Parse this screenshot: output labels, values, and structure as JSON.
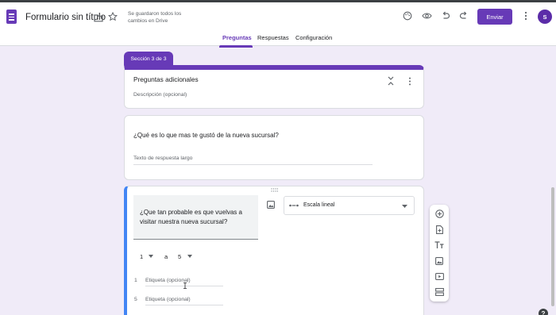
{
  "header": {
    "title": "Formulario sin título",
    "saved_status": "Se guardaron todos los cambios en Drive",
    "send_label": "Enviar",
    "avatar_letter": "S"
  },
  "tabs": [
    {
      "label": "Preguntas",
      "active": true
    },
    {
      "label": "Respuestas",
      "active": false
    },
    {
      "label": "Configuración",
      "active": false
    }
  ],
  "section": {
    "badge": "Sección 3 de 3",
    "title": "Preguntas adicionales",
    "description_placeholder": "Descripción (opcional)"
  },
  "question1": {
    "title": "¿Qué es lo que mas te gustó de la nueva sucursal?",
    "answer_placeholder": "Texto de respuesta largo"
  },
  "question2": {
    "title": "¿Que tan probable es que vuelvas a visitar nuestra nueva sucursal?",
    "type_label": "Escala lineal",
    "scale_from": "1",
    "scale_to_word": "a",
    "scale_to": "5",
    "label_1_num": "1",
    "label_1_placeholder": "Etiqueta (opcional)",
    "label_5_num": "5",
    "label_5_placeholder": "Etiqueta (opcional)"
  },
  "colors": {
    "accent": "#673ab7",
    "background": "#f0ebf8",
    "active_border": "#4285f4"
  },
  "icons": [
    "folder-icon",
    "star-icon",
    "palette-icon",
    "eye-icon",
    "undo-icon",
    "redo-icon",
    "more-vert-icon",
    "add-circle-icon",
    "import-icon",
    "title-icon",
    "image-icon",
    "video-icon",
    "section-icon",
    "help-icon"
  ]
}
